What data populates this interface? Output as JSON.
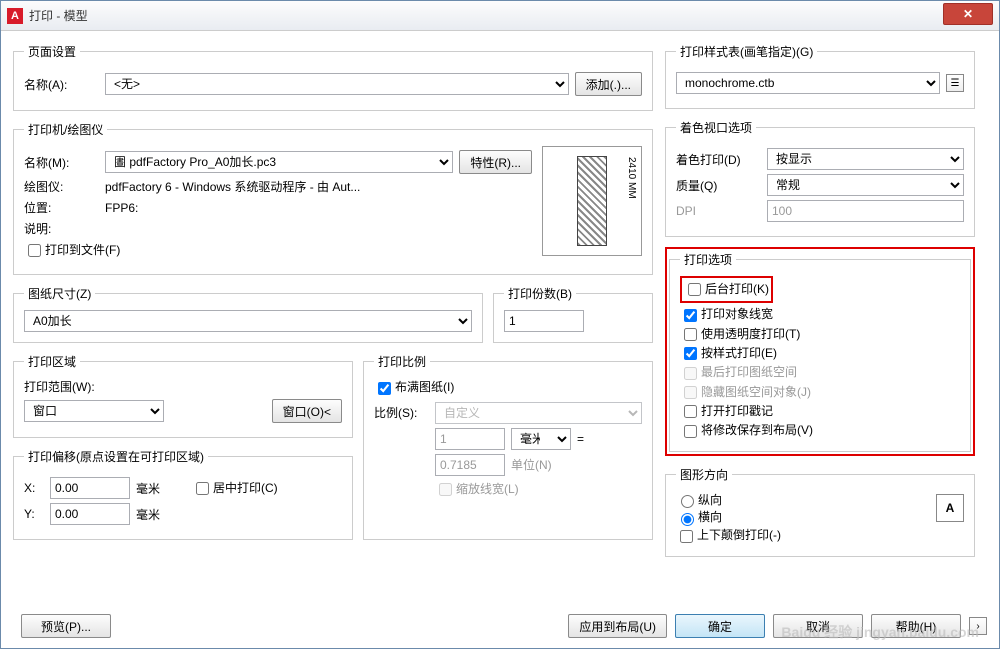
{
  "window": {
    "title": "打印 - 模型",
    "close": "✕"
  },
  "pageSetup": {
    "legend": "页面设置",
    "nameLabel": "名称(A):",
    "name": "<无>",
    "addBtn": "添加(.)..."
  },
  "printer": {
    "legend": "打印机/绘图仪",
    "nameLabel": "名称(M):",
    "name": "圕 pdfFactory Pro_A0加长.pc3",
    "propsBtn": "特性(R)...",
    "plotterLabel": "绘图仪:",
    "plotter": "pdfFactory 6 - Windows 系统驱动程序 - 由 Aut...",
    "posLabel": "位置:",
    "pos": "FPP6:",
    "descLabel": "说明:",
    "toFile": "打印到文件(F)",
    "previewDim": "2410 MM"
  },
  "paper": {
    "legend": "图纸尺寸(Z)",
    "value": "A0加长"
  },
  "copies": {
    "legend": "打印份数(B)",
    "value": "1"
  },
  "area": {
    "legend": "打印区域",
    "whatLabel": "打印范围(W):",
    "what": "窗口",
    "windowBtn": "窗口(O)<"
  },
  "scale": {
    "legend": "打印比例",
    "fit": "布满图纸(I)",
    "ratioLabel": "比例(S):",
    "ratio": "自定义",
    "num": "1",
    "unit": "毫米",
    "eq": "=",
    "den": "0.7185",
    "unitLbl": "单位(N)",
    "lw": "缩放线宽(L)"
  },
  "offset": {
    "legend": "打印偏移(原点设置在可打印区域)",
    "xLabel": "X:",
    "x": "0.00",
    "xUnit": "毫米",
    "yLabel": "Y:",
    "y": "0.00",
    "yUnit": "毫米",
    "center": "居中打印(C)"
  },
  "styleTable": {
    "legend": "打印样式表(画笔指定)(G)",
    "value": "monochrome.ctb"
  },
  "shade": {
    "legend": "着色视口选项",
    "sLabel": "着色打印(D)",
    "s": "按显示",
    "qLabel": "质量(Q)",
    "q": "常规",
    "dpiLabel": "DPI",
    "dpi": "100"
  },
  "opts": {
    "legend": "打印选项",
    "bg": "后台打印(K)",
    "lw": "打印对象线宽",
    "tr": "使用透明度打印(T)",
    "st": "按样式打印(E)",
    "ps": "最后打印图纸空间",
    "hide": "隐藏图纸空间对象(J)",
    "stamp": "打开打印戳记",
    "save": "将修改保存到布局(V)"
  },
  "orient": {
    "legend": "图形方向",
    "p": "纵向",
    "l": "横向",
    "up": "上下颠倒打印(-)",
    "icon": "A"
  },
  "footer": {
    "preview": "预览(P)...",
    "apply": "应用到布局(U)",
    "ok": "确定",
    "cancel": "取消",
    "help": "帮助(H)"
  },
  "watermark": "Baidu 经验 jingyan.baidu.com"
}
